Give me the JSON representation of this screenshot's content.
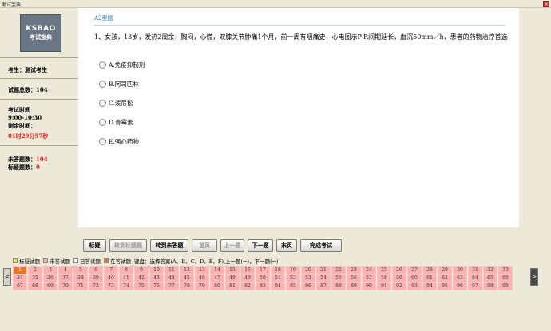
{
  "window": {
    "title": "考试宝典",
    "close_label": "×"
  },
  "sidebar": {
    "logo_line1": "KSBAO",
    "logo_line2": "考试宝典",
    "candidate_label": "考生：",
    "candidate_name": "测试考生",
    "total_label": "试题总数：",
    "total_count": "104",
    "exam_time_label": "考试时间",
    "exam_time_value": "9:00-10:30",
    "remaining_label": "剩余时间：",
    "remaining_value": "01时29分57秒",
    "unanswered_label": "未答题数：",
    "unanswered_count": "104",
    "marked_label": "标疑题数：",
    "marked_count": "0"
  },
  "question": {
    "type": "A2型题",
    "text": "1、女孩，13岁，发热2周余，胸闷，心慌，双膝关节肿痛1个月，前一周有咽痛史，心电图示P-R间期延长，血沉50mm／h，患者的药物治疗首选",
    "options": [
      {
        "label": "A.免疫抑制剂"
      },
      {
        "label": "B.阿司匹林"
      },
      {
        "label": "C.泼尼松"
      },
      {
        "label": "D.青霉素"
      },
      {
        "label": "E.强心药物"
      }
    ]
  },
  "toolbar": {
    "buttons": [
      {
        "label": "标疑",
        "enabled": true
      },
      {
        "label": "转到标疑题",
        "enabled": false
      },
      {
        "label": "转到未答题",
        "enabled": true
      },
      {
        "label": "首页",
        "enabled": false
      },
      {
        "label": "上一题",
        "enabled": false
      },
      {
        "label": "下一题",
        "enabled": true
      },
      {
        "label": "末页",
        "enabled": true
      },
      {
        "label": "完成考试",
        "enabled": true
      }
    ]
  },
  "legend": {
    "items": [
      {
        "label": "标疑试题",
        "color": "#f5e24a"
      },
      {
        "label": "未答试题",
        "color": "#ffb0b0"
      },
      {
        "label": "已答试题",
        "color": "#ffffff"
      },
      {
        "label": "在答试题",
        "color": "#e7761c"
      }
    ],
    "hint": "键盘：选择答案(A、B、C、D、E、F),上一题(←)，下一题(→)"
  },
  "question_grid": {
    "current": 1,
    "row1": [
      "1",
      "2",
      "3",
      "4",
      "5",
      "6",
      "7",
      "8",
      "9",
      "10",
      "11",
      "12",
      "13",
      "14",
      "15",
      "16",
      "17",
      "18",
      "19",
      "20",
      "21",
      "22",
      "23",
      "24",
      "25",
      "26",
      "27",
      "28",
      "29",
      "30",
      "31",
      "32",
      "33"
    ],
    "row2": [
      "34",
      "35",
      "36",
      "37",
      "38",
      "39",
      "40",
      "41",
      "42",
      "43",
      "44",
      "45",
      "46",
      "47",
      "48",
      "49",
      "50",
      "51",
      "52",
      "53",
      "54",
      "55",
      "56",
      "57",
      "58",
      "59",
      "60",
      "61",
      "62",
      "63",
      "64",
      "65",
      "66"
    ],
    "row3": [
      "67",
      "68",
      "69",
      "70",
      "71",
      "72",
      "73",
      "74",
      "75",
      "76",
      "77",
      "78",
      "79",
      "80",
      "81",
      "82",
      "83",
      "84",
      "85",
      "86",
      "87",
      "88",
      "89",
      "90",
      "91",
      "92",
      "93",
      "94",
      "95",
      "96",
      "97",
      "98",
      "99"
    ],
    "prev_label": "<",
    "next_label": ">"
  },
  "colors": {
    "accent": "#2d6fc0",
    "warning": "#e0201a",
    "unanswered": "#ffb0b0",
    "current": "#e7761c"
  }
}
